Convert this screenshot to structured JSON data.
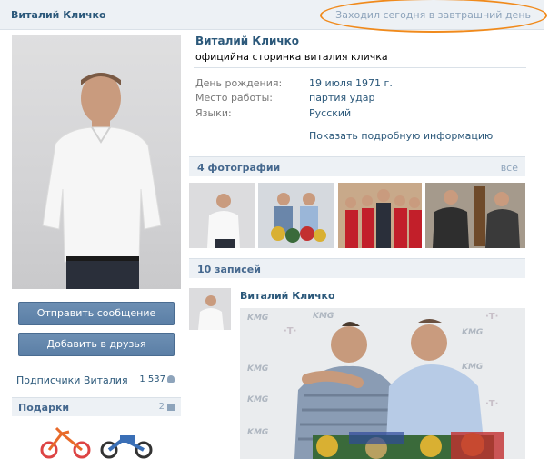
{
  "header": {
    "name": "Виталий Кличко",
    "status": "Заходил сегодня в завтрашний день"
  },
  "profile": {
    "name": "Виталий Кличко",
    "status": "официйна сторинка виталия кличка",
    "info": [
      {
        "label": "День рождения:",
        "value": "19 июля 1971 г."
      },
      {
        "label": "Место работы:",
        "value": "партия удар"
      },
      {
        "label": "Языки:",
        "value": "Русский"
      }
    ],
    "more_link": "Показать подробную информацию"
  },
  "actions": {
    "send_message": "Отправить сообщение",
    "add_friend": "Добавить в друзья"
  },
  "subscribers": {
    "label": "Подписчики Виталия",
    "count": "1 537"
  },
  "gifts": {
    "title": "Подарки",
    "count": "2"
  },
  "photos": {
    "title": "4 фотографии",
    "all_link": "все"
  },
  "wall": {
    "title": "10 записей",
    "post_author": "Виталий Кличко",
    "logo_text": "KMG"
  },
  "icons": [
    "user-icon",
    "gift-icon"
  ],
  "colors": {
    "link": "#2b587a",
    "header_bg": "#edf1f5",
    "button": "#5b7fa6",
    "highlight": "#f08a1c"
  }
}
